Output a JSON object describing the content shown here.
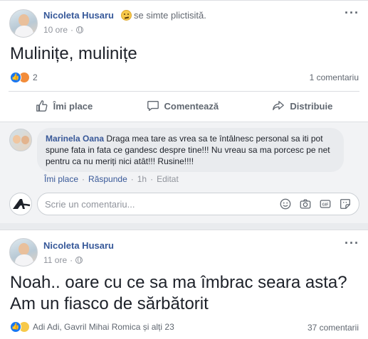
{
  "post1": {
    "author": "Nicoleta Husaru",
    "feeling": "se simte plictisită.",
    "time": "10 ore",
    "text": "Mulinițe, mulinițe",
    "reaction_count": "2",
    "comments_count": "1 comentariu",
    "actions": {
      "like": "Îmi place",
      "comment": "Comentează",
      "share": "Distribuie"
    },
    "comment": {
      "author": "Marinela Oana",
      "text": "Draga mea tare as vrea sa te întâlnesc personal sa iti pot spune fata in fata ce gandesc despre tine!!! Nu vreau sa ma porcesc pe net pentru ca nu meriți nici atât!!! Rusine!!!!",
      "like": "Îmi place",
      "reply": "Răspunde",
      "time": "1h",
      "edited": "Editat"
    },
    "write_placeholder": "Scrie un comentariu..."
  },
  "post2": {
    "author": "Nicoleta Husaru",
    "time": "11 ore",
    "text_line1": "Noah.. oare cu ce sa ma îmbrac seara asta?",
    "text_line2": "Am un fiasco de sărbătorit",
    "reactors": "Adi Adi, Gavril Mihai Romica și alți 23",
    "comments_count": "37 comentarii"
  },
  "colors": {
    "link": "#365899",
    "like_blue": "#1877f2",
    "bg": "#e9ebee"
  },
  "icons": [
    "globe-icon",
    "more-icon",
    "like-icon",
    "comment-icon",
    "share-icon",
    "emoji-icon",
    "camera-icon",
    "gif-icon",
    "sticker-icon"
  ]
}
